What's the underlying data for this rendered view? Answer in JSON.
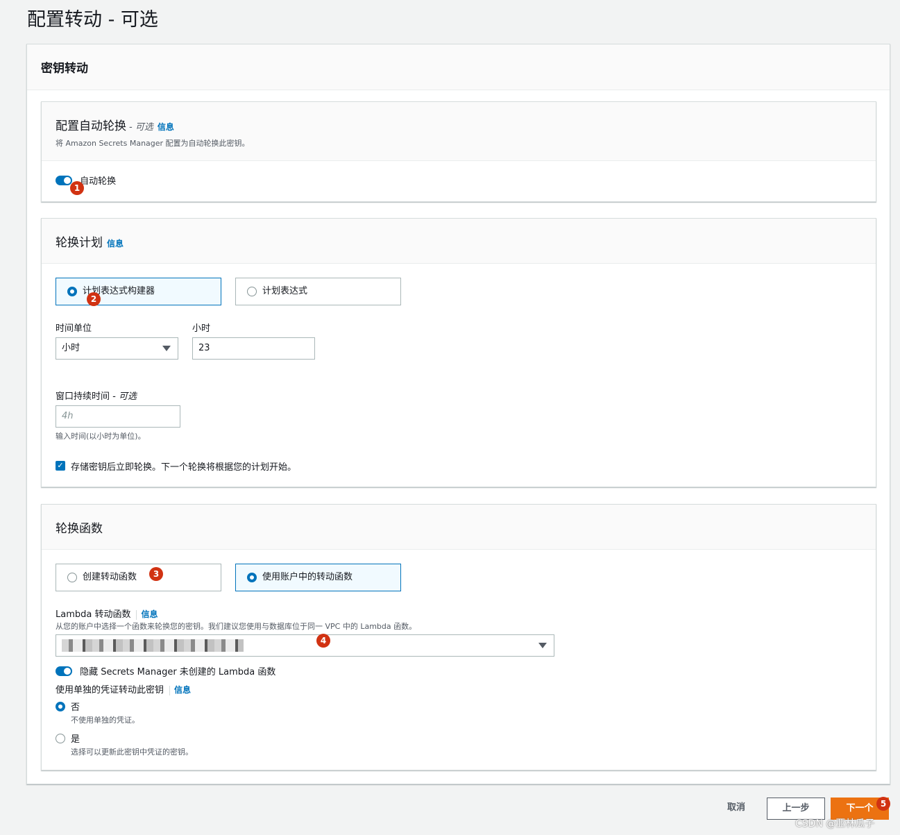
{
  "page": {
    "title": "配置转动 - 可选"
  },
  "outer": {
    "title": "密钥转动"
  },
  "auto_rotation": {
    "title": "配置自动轮换",
    "optional": "- 可选",
    "info": "信息",
    "description": "将 Amazon Secrets Manager 配置为自动轮换此密钥。",
    "toggle_label": "自动轮换",
    "toggle_on": true
  },
  "schedule": {
    "title": "轮换计划",
    "info": "信息",
    "options": [
      "计划表达式构建器",
      "计划表达式"
    ],
    "selected_index": 0,
    "time_unit_label": "时间单位",
    "time_unit_value": "小时",
    "hours_label": "小时",
    "hours_value": "23",
    "window_label": "窗口持续时间",
    "window_optional": "- 可选",
    "window_placeholder": "4h",
    "window_hint": "输入时间(以小时为单位)。",
    "rotate_immediately_label": "存储密钥后立即轮换。下一个轮换将根据您的计划开始。",
    "rotate_immediately_checked": true
  },
  "rotation_function": {
    "title": "轮换函数",
    "options": [
      "创建转动函数",
      "使用账户中的转动函数"
    ],
    "selected_index": 1,
    "lambda_label": "Lambda 转动函数",
    "info": "信息",
    "lambda_hint": "从您的账户中选择一个函数来轮换您的密钥。我们建议您使用与数据库位于同一 VPC 中的 Lambda 函数。",
    "hide_toggle_label": "隐藏 Secrets Manager 未创建的 Lambda 函数",
    "separate_creds_label": "使用单独的凭证转动此密钥",
    "separate_creds_info": "信息",
    "no_label": "否",
    "no_hint": "不使用单独的凭证。",
    "yes_label": "是",
    "yes_hint": "选择可以更新此密钥中凭证的密钥。"
  },
  "footer": {
    "cancel": "取消",
    "previous": "上一步",
    "next": "下一个"
  },
  "badges": [
    "1",
    "2",
    "3",
    "4",
    "5"
  ],
  "watermark": "CSDN @亚林瓜子",
  "colors": {
    "accent": "#0073bb",
    "primary_button": "#ec7211",
    "badge": "#d13212"
  }
}
